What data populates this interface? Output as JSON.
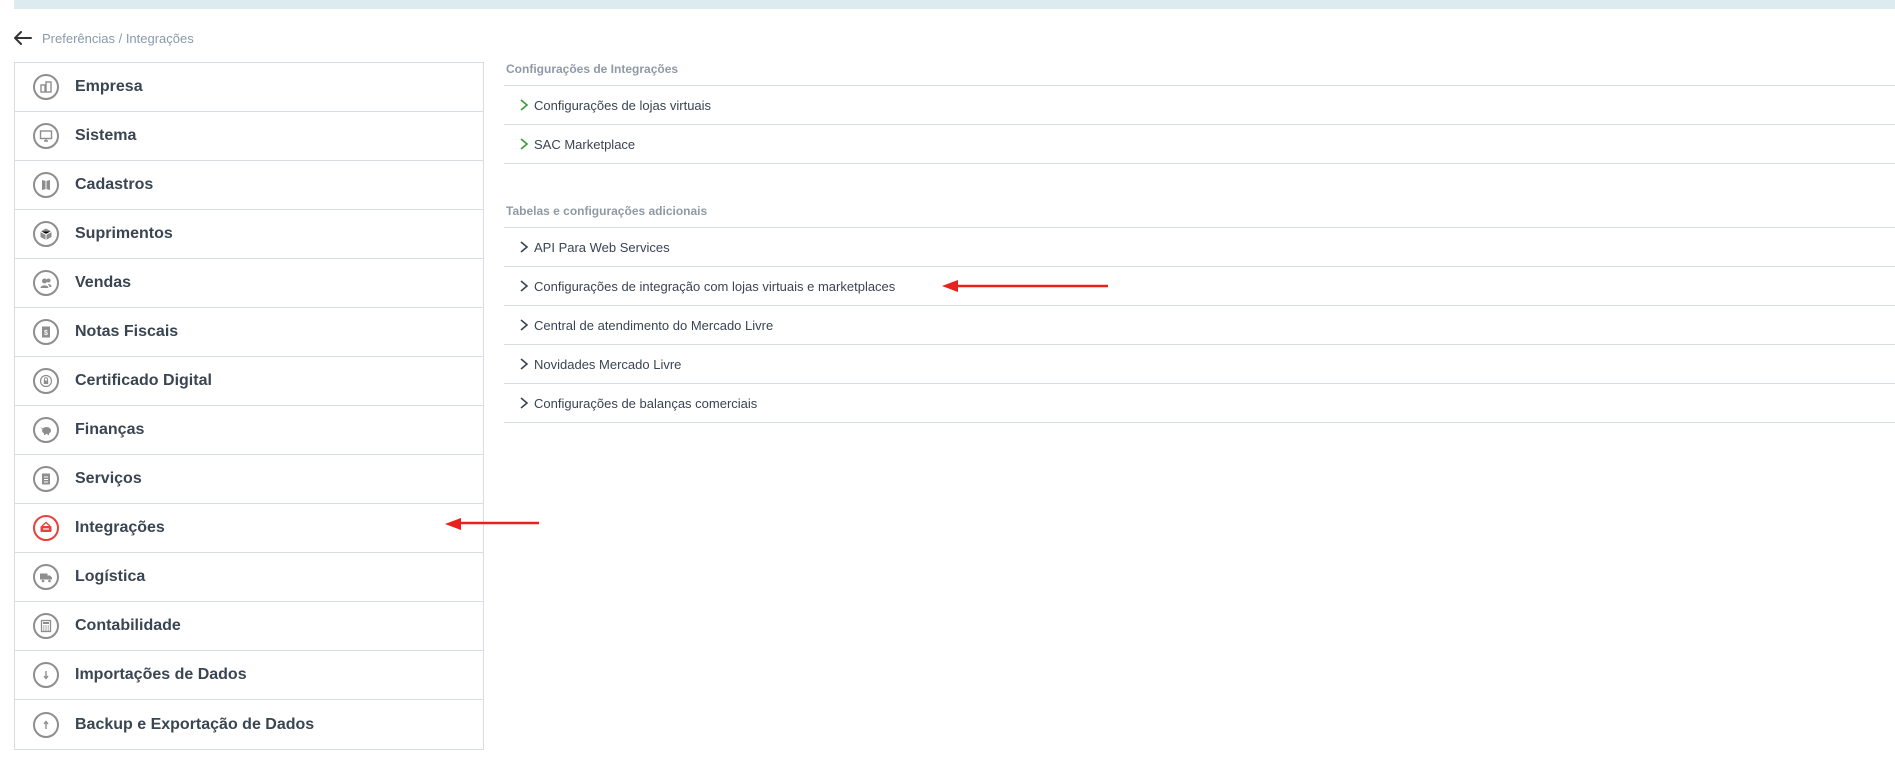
{
  "breadcrumb": {
    "back_icon": "arrow-left-icon",
    "text": "Preferências / Integrações"
  },
  "sidebar": {
    "items": [
      {
        "label": "Empresa",
        "icon": "building-icon"
      },
      {
        "label": "Sistema",
        "icon": "monitor-icon"
      },
      {
        "label": "Cadastros",
        "icon": "book-icon"
      },
      {
        "label": "Suprimentos",
        "icon": "box-icon"
      },
      {
        "label": "Vendas",
        "icon": "users-icon"
      },
      {
        "label": "Notas Fiscais",
        "icon": "receipt-icon"
      },
      {
        "label": "Certificado Digital",
        "icon": "lock-icon"
      },
      {
        "label": "Finanças",
        "icon": "piggy-bank-icon"
      },
      {
        "label": "Serviços",
        "icon": "clipboard-icon"
      },
      {
        "label": "Integrações",
        "icon": "integration-icon",
        "active": true
      },
      {
        "label": "Logística",
        "icon": "truck-icon"
      },
      {
        "label": "Contabilidade",
        "icon": "calculator-icon"
      },
      {
        "label": "Importações de Dados",
        "icon": "import-icon"
      },
      {
        "label": "Backup e Exportação de Dados",
        "icon": "export-icon"
      }
    ]
  },
  "main": {
    "sections": [
      {
        "title": "Configurações de Integrações",
        "chevron_color": "#3a9a3a",
        "links": [
          "Configurações de lojas virtuais",
          "SAC Marketplace"
        ]
      },
      {
        "title": "Tabelas e configurações adicionais",
        "chevron_color": "#3a4552",
        "links": [
          "API Para Web Services",
          "Configurações de integração com lojas virtuais e marketplaces",
          "Central de atendimento do Mercado Livre",
          "Novidades Mercado Livre",
          "Configurações de balanças comerciais"
        ]
      }
    ]
  },
  "colors": {
    "accent_red": "#e8403d",
    "annotation_arrow": "#e8211c",
    "topbar": "#dcebef"
  }
}
